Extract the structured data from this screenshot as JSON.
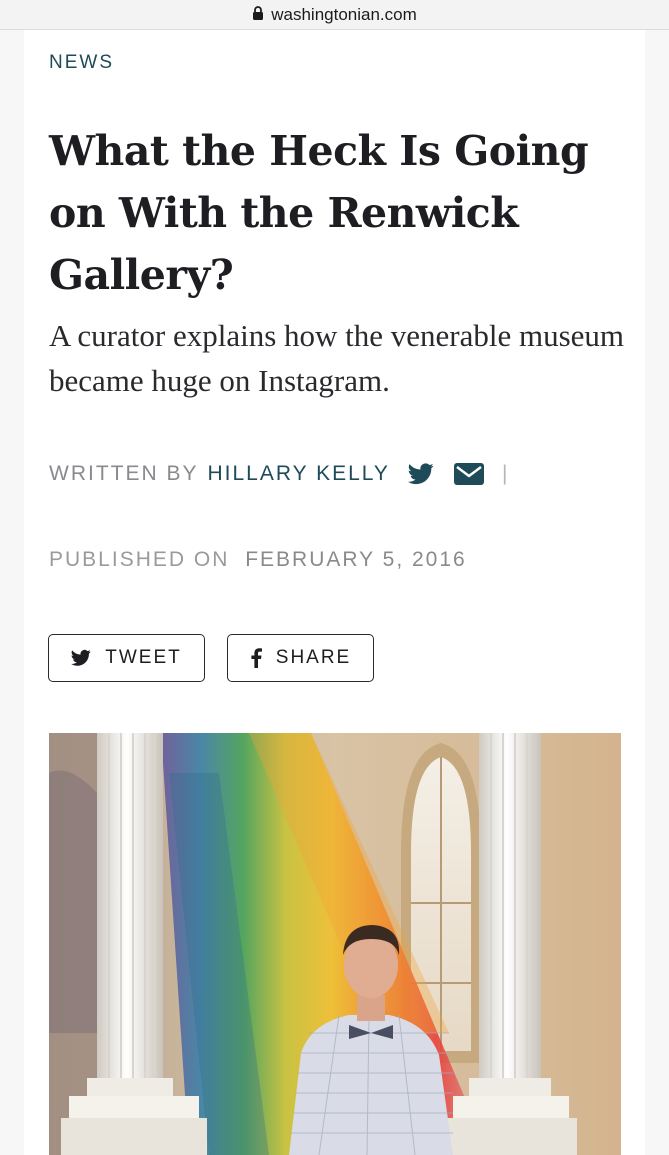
{
  "browser": {
    "url": "washingtonian.com"
  },
  "article": {
    "section": "NEWS",
    "headline": "What the Heck Is Going on With the Renwick Gallery?",
    "dek": "A curator explains how the venerable museum became huge on Instagram.",
    "byline": {
      "prefix": "WRITTEN BY",
      "author": "HILLARY KELLY",
      "separator": "|"
    },
    "published": {
      "prefix": "PUBLISHED ON",
      "date": "FEBRUARY 5, 2016"
    },
    "share": {
      "tweet_label": "TWEET",
      "share_label": "SHARE"
    }
  },
  "icons": {
    "lock": "lock-icon",
    "twitter": "twitter-icon",
    "mail": "mail-icon",
    "facebook": "facebook-icon"
  },
  "colors": {
    "accent": "#1f4a57",
    "headline": "#1d1d22",
    "meta": "#8a8a8e"
  }
}
